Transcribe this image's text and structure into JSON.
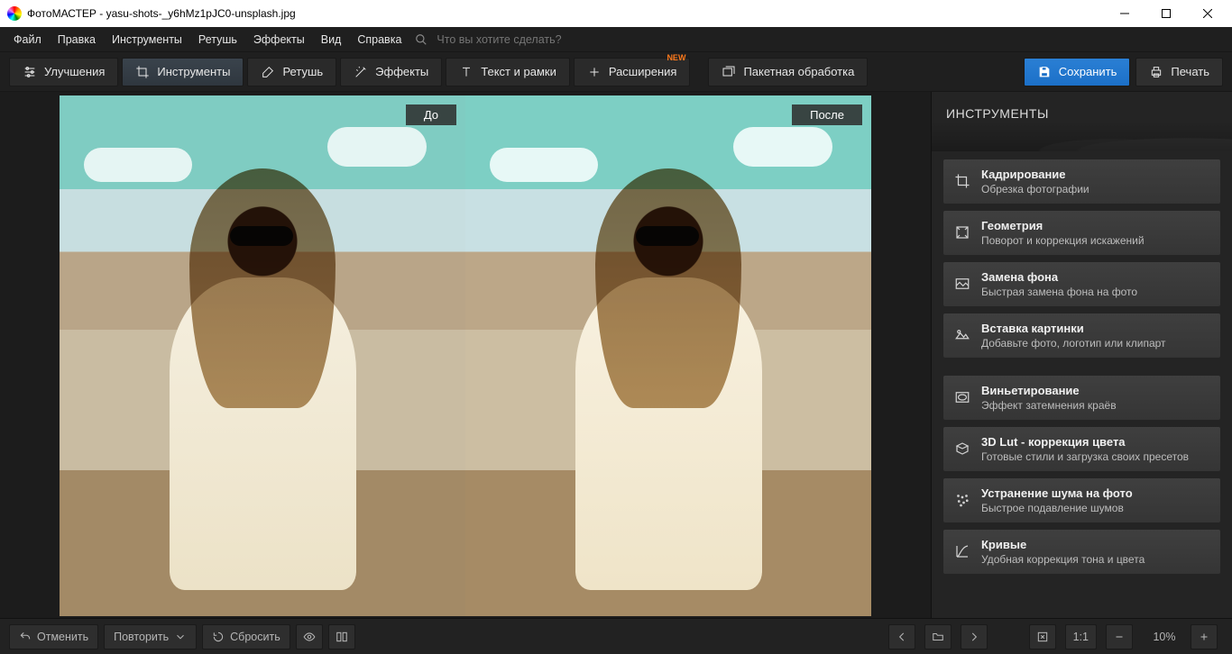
{
  "window": {
    "app": "ФотоМАСТЕР",
    "file": "yasu-shots-_y6hMz1pJC0-unsplash.jpg"
  },
  "menu": {
    "items": [
      "Файл",
      "Правка",
      "Инструменты",
      "Ретушь",
      "Эффекты",
      "Вид",
      "Справка"
    ],
    "search_placeholder": "Что вы хотите сделать?"
  },
  "tabs": {
    "improve": "Улучшения",
    "tools": "Инструменты",
    "retouch": "Ретушь",
    "effects": "Эффекты",
    "text": "Текст и рамки",
    "ext": "Расширения",
    "new": "NEW",
    "batch": "Пакетная обработка"
  },
  "actions": {
    "save": "Сохранить",
    "print": "Печать"
  },
  "preview": {
    "before": "До",
    "after": "После"
  },
  "panel": {
    "header": "ИНСТРУМЕНТЫ",
    "g1": [
      {
        "t": "Кадрирование",
        "s": "Обрезка фотографии",
        "icon": "crop"
      },
      {
        "t": "Геометрия",
        "s": "Поворот и коррекция искажений",
        "icon": "geometry"
      },
      {
        "t": "Замена фона",
        "s": "Быстрая замена фона на фото",
        "icon": "bgswap"
      },
      {
        "t": "Вставка картинки",
        "s": "Добавьте фото, логотип или клипарт",
        "icon": "insert"
      }
    ],
    "g2": [
      {
        "t": "Виньетирование",
        "s": "Эффект затемнения краёв",
        "icon": "vignette"
      },
      {
        "t": "3D Lut - коррекция цвета",
        "s": "Готовые стили и загрузка своих пресетов",
        "icon": "lut"
      },
      {
        "t": "Устранение шума на фото",
        "s": "Быстрое подавление шумов",
        "icon": "noise"
      },
      {
        "t": "Кривые",
        "s": "Удобная коррекция тона и цвета",
        "icon": "curves"
      }
    ]
  },
  "footer": {
    "undo": "Отменить",
    "redo": "Повторить",
    "reset": "Сбросить",
    "fit": "1:1",
    "zoom": "10%"
  }
}
